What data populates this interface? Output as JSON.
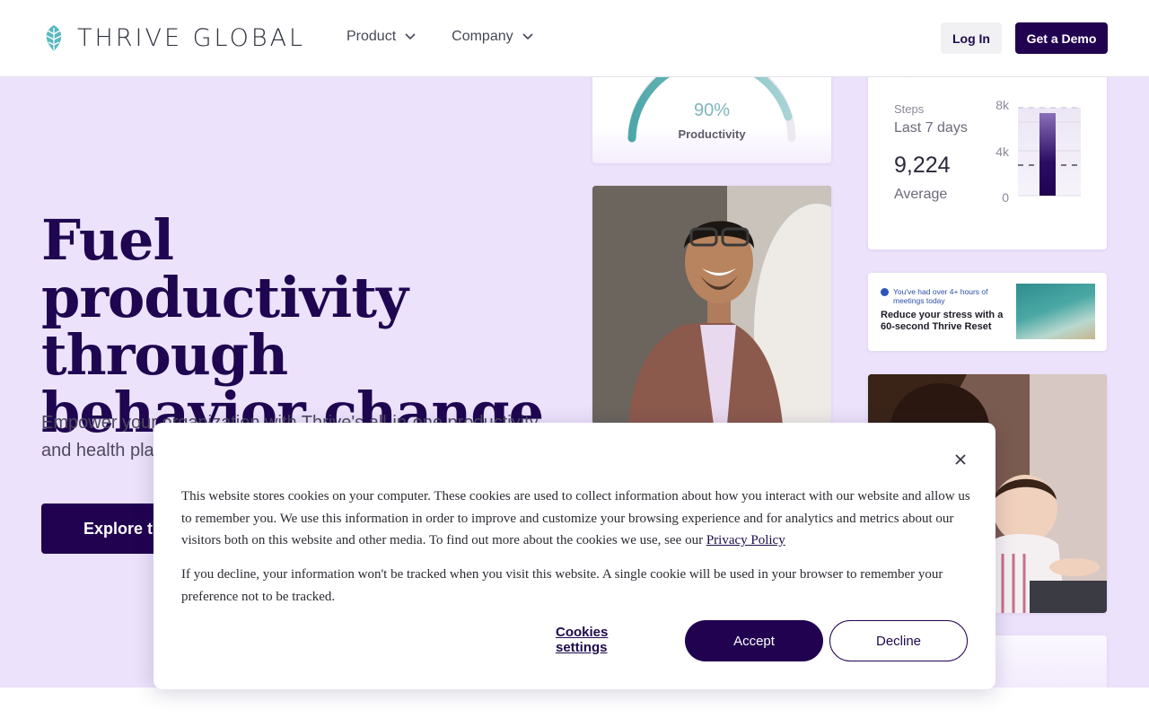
{
  "header": {
    "logo_text": "THRIVE GLOBAL",
    "nav": [
      {
        "label": "Product"
      },
      {
        "label": "Company"
      }
    ],
    "login_label": "Log In",
    "demo_label": "Get a Demo"
  },
  "hero": {
    "title": "Fuel productivity through behavior change",
    "subtitle": "Empower your organization with Thrive's all-in-one productivity and health platform.",
    "cta_label": "Explore the platform"
  },
  "cards": {
    "gauge": {
      "value": "90%",
      "label": "Productivity",
      "level": 0.9
    },
    "steps": {
      "label": "Steps",
      "range": "Last 7 days",
      "value": "9,224",
      "caption": "Average",
      "ticks": [
        "8k",
        "4k",
        "0"
      ]
    },
    "reset": {
      "note": "You've had over 4+ hours of meetings today",
      "title": "Reduce your stress with a 60-second Thrive Reset"
    }
  },
  "cookie": {
    "paragraph1": "This website stores cookies on your computer. These cookies are used to collect information about how you interact with our website and allow us to remember you. We use this information in order to improve and customize your browsing experience and for analytics and metrics about our visitors both on this website and other media. To find out more about the cookies we use, see our",
    "privacy_link": "Privacy Policy",
    "paragraph2": "If you decline, your information won't be tracked when you visit this website. A single cookie will be used in your browser to remember your preference not to be tracked.",
    "settings_label": "Cookies settings",
    "accept_label": "Accept",
    "decline_label": "Decline"
  },
  "colors": {
    "brand": "#210250",
    "hero_bg": "#ece2fb",
    "accent_teal": "#7fb6bd"
  }
}
